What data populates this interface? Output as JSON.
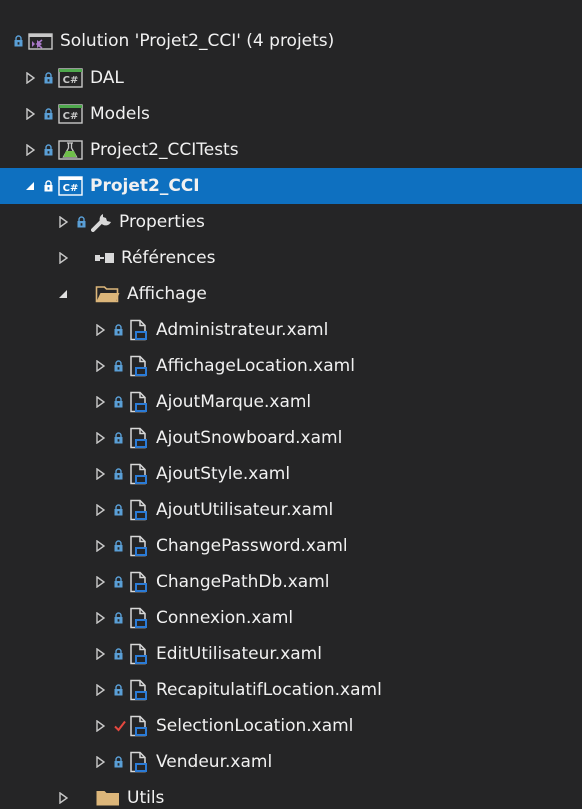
{
  "solution_explorer": {
    "solution": {
      "label": "Solution 'Projet2_CCI' (4 projets)"
    },
    "projects": {
      "dal": {
        "label": "DAL"
      },
      "models": {
        "label": "Models"
      },
      "tests": {
        "label": "Project2_CCITests"
      },
      "main": {
        "label": "Projet2_CCI"
      }
    },
    "nodes": {
      "properties": {
        "label": "Properties"
      },
      "references": {
        "label": "Références"
      },
      "affichage": {
        "label": "Affichage"
      },
      "utils": {
        "label": "Utils"
      }
    },
    "files": [
      {
        "label": "Administrateur.xaml"
      },
      {
        "label": "AffichageLocation.xaml"
      },
      {
        "label": "AjoutMarque.xaml"
      },
      {
        "label": "AjoutSnowboard.xaml"
      },
      {
        "label": "AjoutStyle.xaml"
      },
      {
        "label": "AjoutUtilisateur.xaml"
      },
      {
        "label": "ChangePassword.xaml"
      },
      {
        "label": "ChangePathDb.xaml"
      },
      {
        "label": "Connexion.xaml"
      },
      {
        "label": "EditUtilisateur.xaml"
      },
      {
        "label": "RecapitulatifLocation.xaml"
      },
      {
        "label": "SelectionLocation.xaml"
      },
      {
        "label": "Vendeur.xaml"
      }
    ],
    "icon_labels": {
      "csharp": "C#"
    }
  },
  "colors": {
    "background": "#252526",
    "selection": "#0e70c0",
    "text": "#f1f1f1",
    "lock": "#5a9fd6",
    "folder": "#dcb67a",
    "checkmark": "#e5483f",
    "arrow": "#c8c8c8"
  }
}
